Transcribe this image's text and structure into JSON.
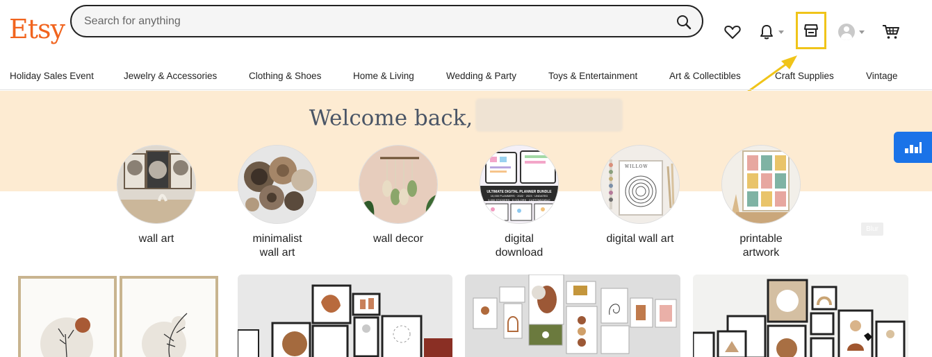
{
  "header": {
    "logo_text": "Etsy",
    "search": {
      "placeholder": "Search for anything",
      "value": ""
    },
    "icons": [
      "search-icon",
      "heart-icon",
      "bell-icon",
      "shop-icon",
      "user-avatar-icon",
      "cart-icon"
    ],
    "highlight_color": "#F0C419",
    "brand_color": "#F1641E"
  },
  "nav": {
    "items": [
      "Holiday Sales Event",
      "Jewelry & Accessories",
      "Clothing & Shoes",
      "Home & Living",
      "Wedding & Party",
      "Toys & Entertainment",
      "Art & Collectibles",
      "Craft Supplies",
      "Vintage"
    ]
  },
  "welcome": {
    "text": "Welcome back,"
  },
  "categories": [
    {
      "label": "wall art"
    },
    {
      "label": "minimalist\nwall art"
    },
    {
      "label": "wall decor"
    },
    {
      "label": "digital\ndownload"
    },
    {
      "label": "digital wall art"
    },
    {
      "label": "printable\nartwork"
    }
  ],
  "digital_planner_thumb": {
    "title": "ULTIMATE DIGITAL PLANNER BUNDLE",
    "line1": "10,000 PLANNERS · 2022 · 2023 · UNDATED",
    "line2": "5,000 STICKERS · 6 COLORS · CUSTOMIZABLE"
  },
  "digital_wall_art_thumb": {
    "poster_title": "WILLOW"
  },
  "blur_tag": "Blur",
  "band_color": "#FDEBD2",
  "side_widget_color": "#1a73e8"
}
